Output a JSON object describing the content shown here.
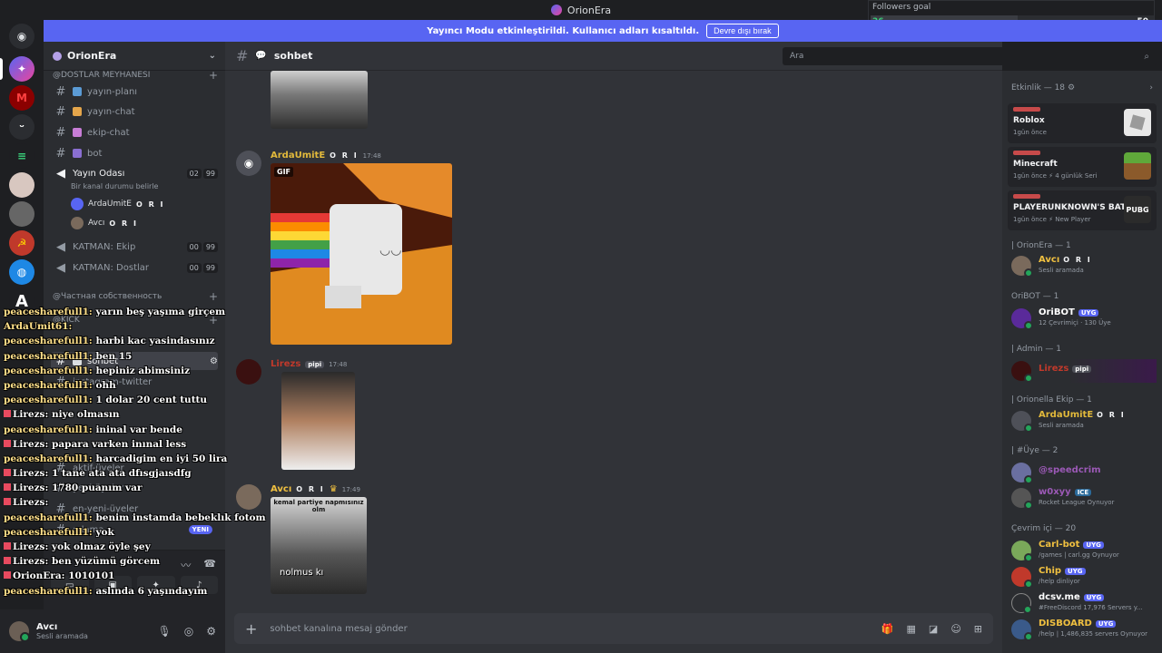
{
  "window": {
    "title": "OrionEra"
  },
  "banner": {
    "text": "Yayıncı Modu etkinleştirildi. Kullanıcı adları kısaltıldı.",
    "button": "Devre dışı bırak"
  },
  "followers_goal": {
    "label": "Followers goal",
    "current": "26",
    "goal": "50",
    "progress": 0.52
  },
  "guild": {
    "name": "OrionEra"
  },
  "channels": {
    "category1": "@DOSTLAR MEYHANESI",
    "text": [
      "yayın-planı",
      "yayın-chat",
      "ekip-chat",
      "bot"
    ],
    "voice_room": {
      "name": "Yayın Odası",
      "sub": "Bir kanal durumu belirle",
      "count_a": "02",
      "count_b": "99",
      "users": [
        {
          "name": "ArdaUmitE",
          "tag": "O R I"
        },
        {
          "name": "Avcı",
          "tag": "O R I"
        }
      ]
    },
    "voice2": {
      "name": "KATMAN: Ekip",
      "a": "00",
      "b": "99"
    },
    "voice3": {
      "name": "KATMAN: Dostlar",
      "a": "00",
      "b": "99"
    },
    "category2": "@Частная собственность",
    "category3": "@KICK",
    "active": "sohbet",
    "hidden_channels": [
      "instagram-twitter",
      "yeni-üyeler",
      "aktif-üyeler",
      "en-yeni-üyeler",
      "odama"
    ],
    "new_badge": "YENI"
  },
  "chat_overlay": [
    {
      "user": "peacesharefull1:",
      "text": "yarın beş yaşıma girçem",
      "color": "y"
    },
    {
      "user": "ArdaUmit61:",
      "text": "",
      "color": "y"
    },
    {
      "user": "peacesharefull1:",
      "text": "harbi kac yasindasınız",
      "color": "y"
    },
    {
      "user": "peacesharefull1:",
      "text": "ben 15",
      "color": "y"
    },
    {
      "user": "peacesharefull1:",
      "text": "hepiniz abimsiniz",
      "color": "y"
    },
    {
      "user": "peacesharefull1:",
      "text": "ohh",
      "color": "y"
    },
    {
      "user": "peacesharefull1:",
      "text": "1 dolar 20 cent tuttu",
      "color": "y"
    },
    {
      "user": "Lirezs:",
      "text": "niye olmasın",
      "color": "w"
    },
    {
      "user": "peacesharefull1:",
      "text": "ininal var bende",
      "color": "y"
    },
    {
      "user": "Lirezs:",
      "text": "papara varken inınal less",
      "color": "w"
    },
    {
      "user": "peacesharefull1:",
      "text": "harcadigim en iyi 50 lira",
      "color": "y"
    },
    {
      "user": "Lirezs:",
      "text": "1 tane ata ata dfısgjaısdfg",
      "color": "w"
    },
    {
      "user": "Lirezs:",
      "text": "1780 puanım var",
      "color": "w"
    },
    {
      "user": "Lirezs:",
      "text": "",
      "color": "w"
    },
    {
      "user": "peacesharefull1:",
      "text": "benim instamda bebeklık fotom var",
      "color": "y"
    },
    {
      "user": "peacesharefull1:",
      "text": "yok",
      "color": "y"
    },
    {
      "user": "Lirezs:",
      "text": "yok olmaz öyle şey",
      "color": "w"
    },
    {
      "user": "Lirezs:",
      "text": "ben yüzümü görcem",
      "color": "w"
    },
    {
      "user": "OrionEra:",
      "text": "1010101",
      "color": "w"
    },
    {
      "user": "peacesharefull1:",
      "text": "aslında 6 yaşındayım",
      "color": "y"
    }
  ],
  "user_panel": {
    "name": "Avcı",
    "status": "Sesli aramada"
  },
  "main": {
    "channel": "sohbet",
    "search_placeholder": "Ara",
    "composer_placeholder": "sohbet kanalına mesaj gönder",
    "messages": [
      {
        "author": "ArdaUmitE",
        "tag": "O R I",
        "time": "17:48",
        "color": "#e2b93b",
        "gif_label": "GIF"
      },
      {
        "author": "Lirezs",
        "tag": "pipi",
        "time": "17:48",
        "color": "#c0392b"
      },
      {
        "author": "Avcı",
        "tag": "O R I",
        "time": "17:49",
        "color": "#f0c040",
        "caption_top": "kemal partiye napmısınız olm",
        "caption_bottom": "nolmus kı"
      }
    ]
  },
  "members": {
    "activity_header": "Etkinlik — 18",
    "activities": [
      {
        "game": "Roblox",
        "meta": "1gün önce"
      },
      {
        "game": "Minecraft",
        "meta": "1gün önce  ⚡ 4 günlük Seri"
      },
      {
        "game": "PLAYERUNKNOWN'S BAT...",
        "meta": "1gün önce  ⚡ New Player",
        "thumb": "PUBG"
      }
    ],
    "groups": [
      {
        "title": "| OrionEra — 1",
        "members": [
          {
            "name": "Avcı",
            "tag": "O R I",
            "sub": "Sesli aramada",
            "color": "#f0c040"
          }
        ]
      },
      {
        "title": "OriBOT — 1",
        "members": [
          {
            "name": "OriBOT",
            "tag": "UYG",
            "sub": "12 Çevrimiçi · 130 Üye",
            "color": "#ffffff"
          }
        ]
      },
      {
        "title": "| Admin — 1",
        "members": [
          {
            "name": "Lirezs",
            "tag": "pipi",
            "sub": "",
            "color": "#c0392b"
          }
        ]
      },
      {
        "title": "| Orionella Ekip — 1",
        "members": [
          {
            "name": "ArdaUmitE",
            "tag": "O R I",
            "sub": "Sesli aramada",
            "color": "#e2b93b"
          }
        ]
      },
      {
        "title": "| #Üye — 2",
        "members": [
          {
            "name": "@speedcrim",
            "tag": "",
            "sub": "",
            "color": "#9b59b6"
          },
          {
            "name": "w0xyy",
            "tag": "ICE",
            "sub": "Rocket League Oynuyor",
            "color": "#9b59b6"
          }
        ]
      },
      {
        "title": "Çevrim içi — 20",
        "members": [
          {
            "name": "Carl-bot",
            "tag": "UYG",
            "sub": "/games | carl.gg Oynuyor",
            "color": "#f0c040"
          },
          {
            "name": "Chip",
            "tag": "UYG",
            "sub": "/help dinliyor",
            "color": "#f0c040"
          },
          {
            "name": "dcsv.me",
            "tag": "UYG",
            "sub": "#FreeDiscord 17,976 Servers y...",
            "color": "#ffffff"
          },
          {
            "name": "DISBOARD",
            "tag": "UYG",
            "sub": "/help | 1,486,835 servers Oynuyor",
            "color": "#f0c040"
          }
        ]
      }
    ]
  }
}
